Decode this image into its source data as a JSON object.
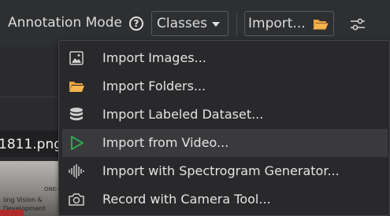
{
  "toolbar": {
    "mode_label": "Annotation Mode",
    "help_icon_glyph": "?",
    "mode_select_value": "Classes",
    "import_button_label": "Import...",
    "icons": [
      "help-icon",
      "chevron-down-icon",
      "folder-icon",
      "sliders-icon"
    ]
  },
  "background": {
    "filename_partial": "1811.png",
    "preview_text": [
      "ONE-HALF",
      "ling Vision &",
      "Development"
    ]
  },
  "import_menu": {
    "items": [
      {
        "label": "Import Images...",
        "icon": "image-icon"
      },
      {
        "label": "Import Folders...",
        "icon": "folder-icon"
      },
      {
        "label": "Import Labeled Dataset...",
        "icon": "database-icon"
      },
      {
        "label": "Import from Video...",
        "icon": "play-icon",
        "highlighted": true
      },
      {
        "label": "Import with Spectrogram Generator...",
        "icon": "waveform-icon"
      },
      {
        "label": "Record with Camera Tool...",
        "icon": "camera-icon"
      }
    ]
  },
  "colors": {
    "background": "#2b2b2d",
    "menu_background": "#29292b",
    "highlight": "#3a3a3d",
    "folder_accent": "#f0a540",
    "video_accent": "#2fa84f"
  }
}
